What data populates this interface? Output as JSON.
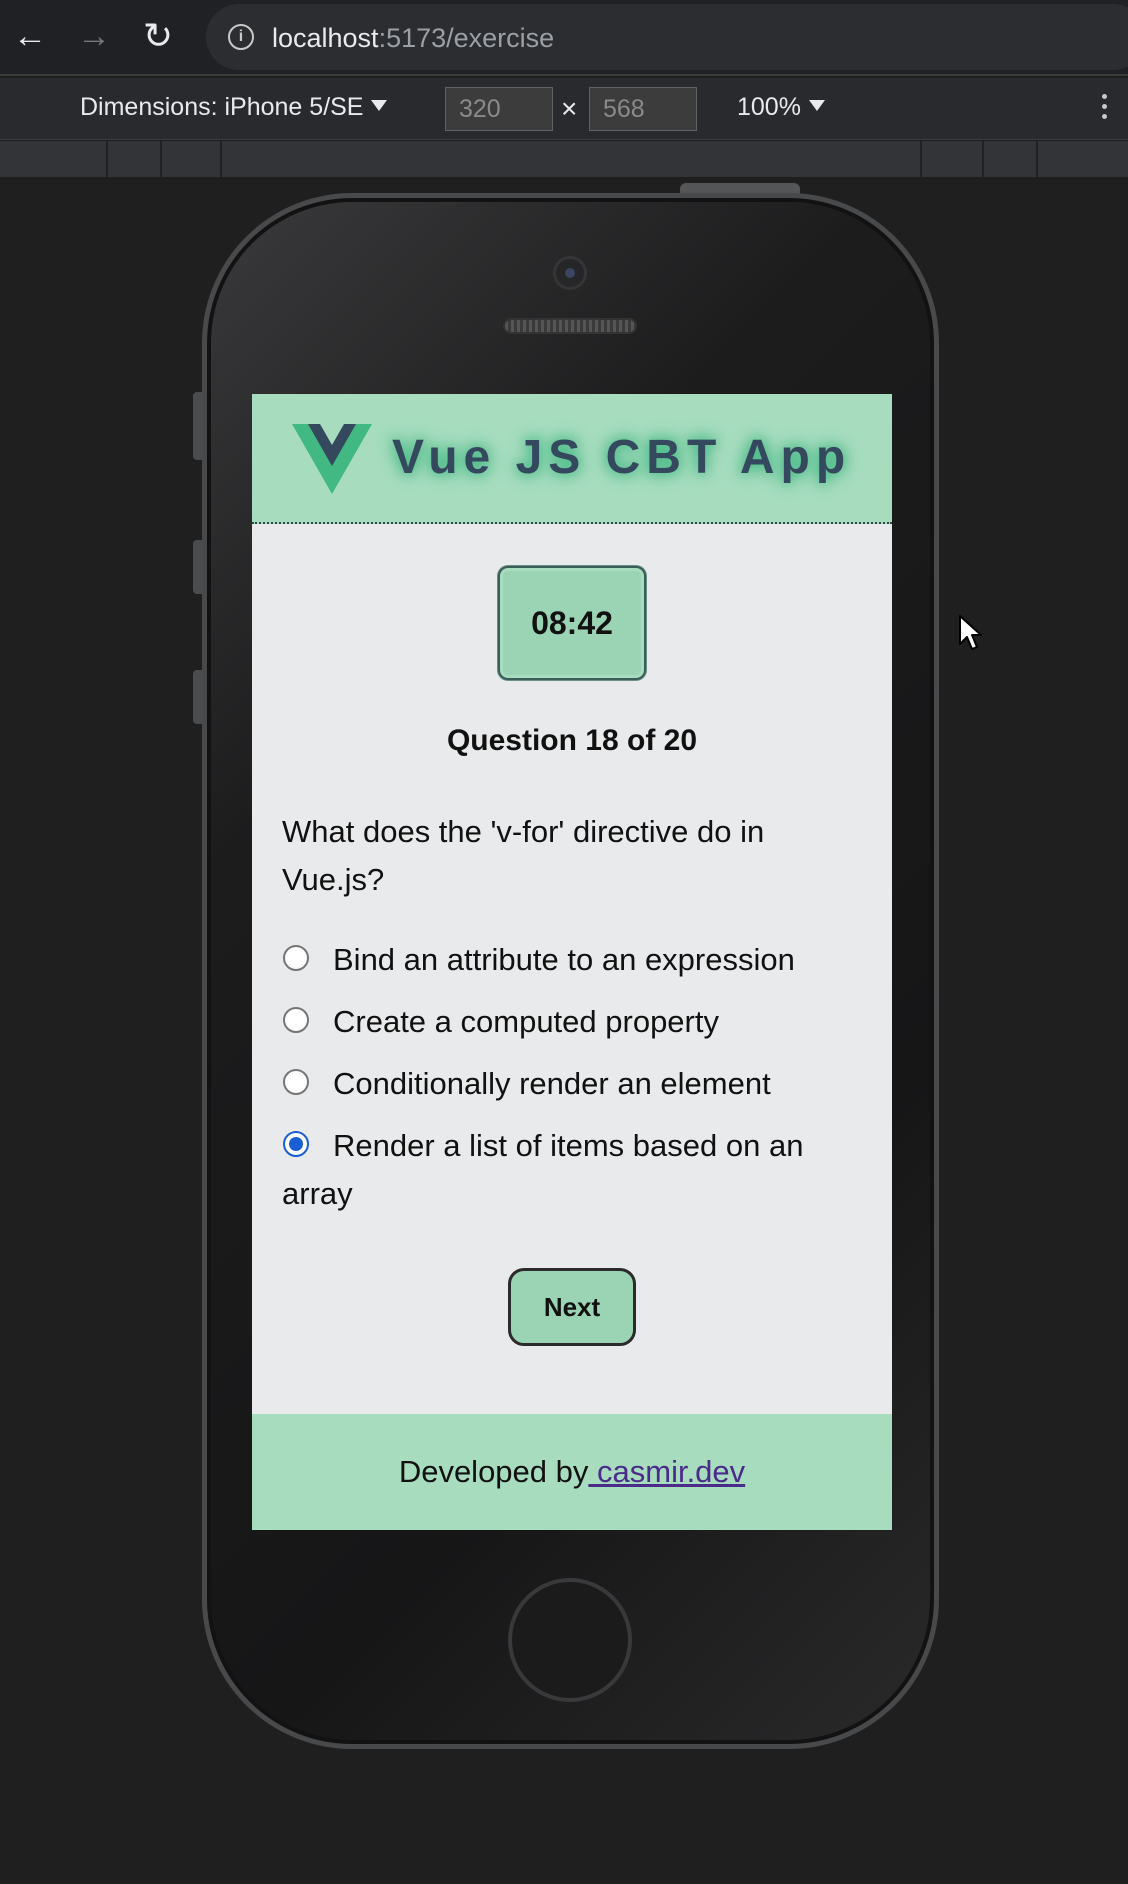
{
  "browser": {
    "url_host": "localhost",
    "url_path": ":5173/exercise"
  },
  "devtools": {
    "dimensions_label": "Dimensions: iPhone 5/SE",
    "width": "320",
    "height": "568",
    "times": "×",
    "zoom": "100%"
  },
  "app": {
    "title": "Vue JS CBT App",
    "timer": "08:42",
    "question_count": "Question 18 of 20",
    "question": "What does the 'v-for' directive do in Vue.js?",
    "options": [
      {
        "label": "Bind an attribute to an expression",
        "selected": false
      },
      {
        "label": "Create a computed property",
        "selected": false
      },
      {
        "label": "Conditionally render an element",
        "selected": false
      },
      {
        "label": "Render a list of items based on an array",
        "selected": true
      }
    ],
    "next_label": "Next",
    "footer_prefix": "Developed by",
    "footer_link": " casmir.dev"
  },
  "colors": {
    "header_bg": "#a7dcbf",
    "vue_green": "#42b883",
    "vue_navy": "#35495e",
    "radio_selected": "#1a5fd1"
  }
}
